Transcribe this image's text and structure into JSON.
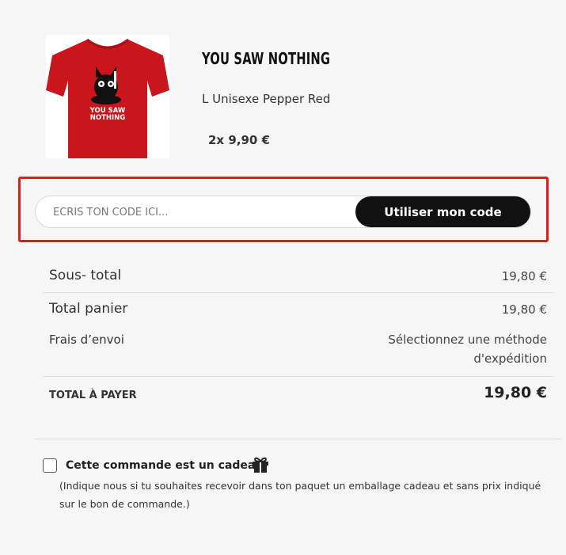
{
  "product": {
    "name": "YOU SAW NOTHING",
    "variant": "L Unisexe Pepper Red",
    "quantity_price": "2x 9,90 €",
    "image_icon": "red-tshirt-black-cat-image",
    "image_text": "YOU SAW NOTHING",
    "image_color": "#c8161c"
  },
  "promo": {
    "placeholder": "ÉCRIS TON CODE ICI...",
    "value": "",
    "button_label": "Utiliser mon code",
    "highlight_color": "#e41a1a"
  },
  "totals": {
    "subtotal_label": "Sous- total",
    "subtotal_value": "19,80 €",
    "cart_total_label": "Total panier",
    "cart_total_value": "19,80 €",
    "shipping_label": "Frais d’envoi",
    "shipping_value_line1": "Sélectionnez une méthode",
    "shipping_value_line2": "d'expédition",
    "grand_total_label": "TOTAL À PAYER",
    "grand_total_value": "19,80 €"
  },
  "gift": {
    "checked": false,
    "label": "Cette commande est un cadeau",
    "icon": "gift-icon",
    "description": "(Indique nous si tu souhaites recevoir dans ton paquet un emballage cadeau et sans prix indiqué sur le bon de commande.)"
  }
}
